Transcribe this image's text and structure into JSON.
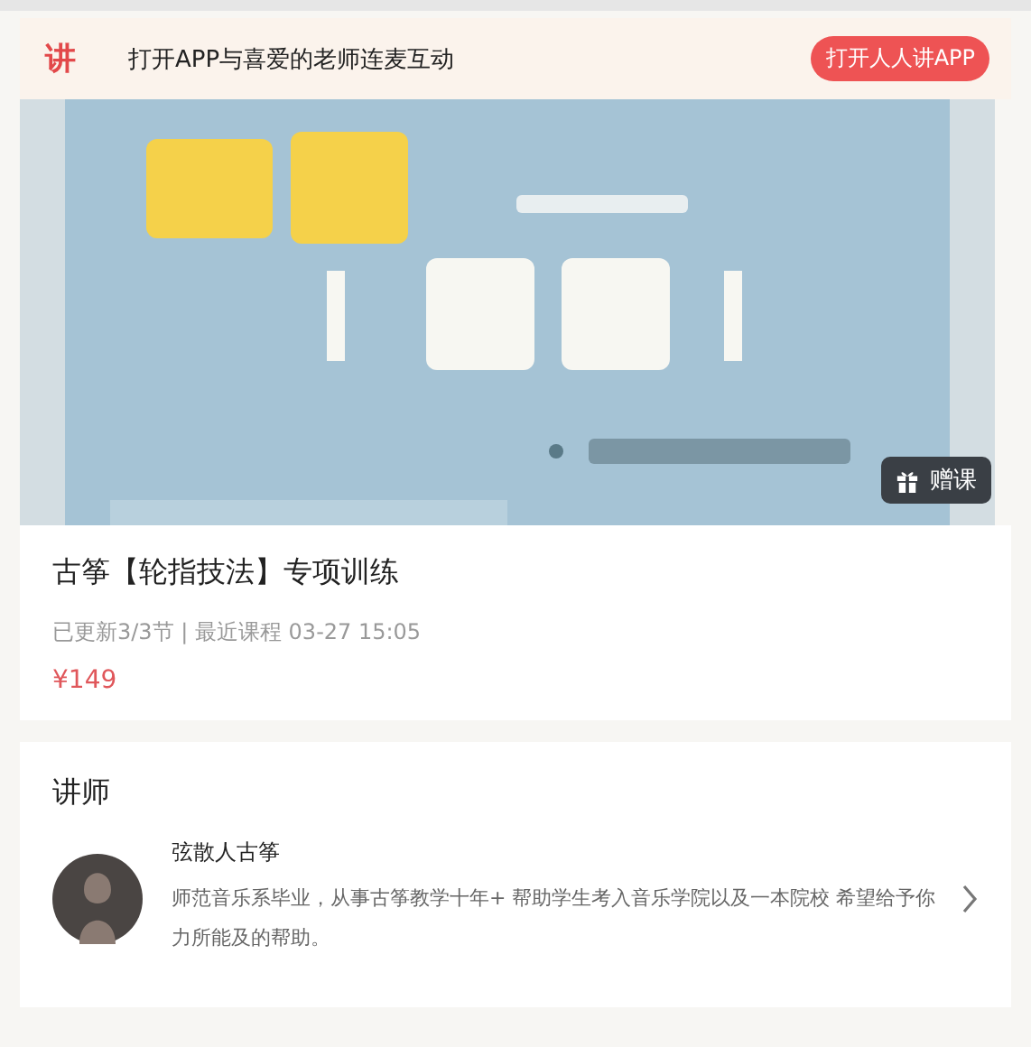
{
  "app_banner": {
    "logo": "讲",
    "text": "打开APP与喜爱的老师连麦互动",
    "button": "打开人人讲APP"
  },
  "cover": {
    "kind": "picture",
    "badge": "赠课"
  },
  "course": {
    "title": "古筝【轮指技法】专项训练",
    "meta": "已更新3/3节 | 最近课程 03-27 15:05",
    "price": "¥149"
  },
  "teacher_section": {
    "heading": "讲师",
    "name": "弦散人古筝",
    "bio": "师范音乐系毕业，从事古筝教学十年+ 帮助学生考入音乐学院以及一本院校 希望给予你力所能及的帮助。"
  }
}
